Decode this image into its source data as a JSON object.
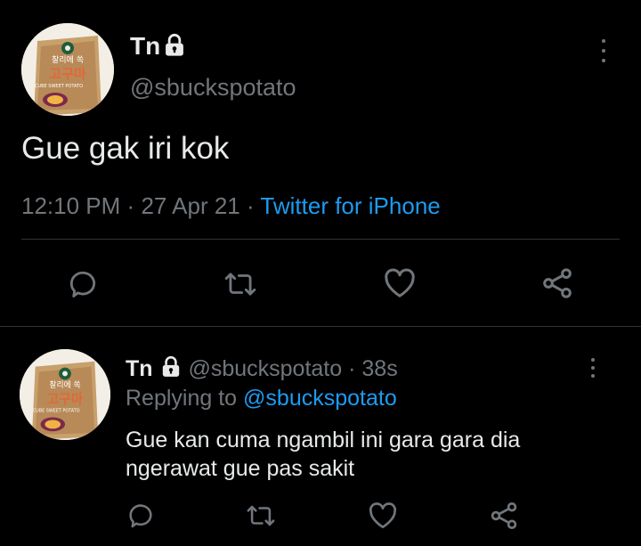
{
  "main_tweet": {
    "display_name": "Tn",
    "handle": "@sbuckspotato",
    "text": "Gue gak iri kok",
    "time": "12:10 PM",
    "sep1": "·",
    "date": "27 Apr 21",
    "sep2": "·",
    "source": "Twitter for iPhone",
    "avatar_text": {
      "brand": "찰리에 쏙",
      "korean": "고구마",
      "english": "CUBE SWEET POTATO"
    }
  },
  "reply_tweet": {
    "display_name": "Tn",
    "handle": "@sbuckspotato",
    "sep": "·",
    "age": "38s",
    "replying_prefix": "Replying to",
    "replying_to": "@sbuckspotato",
    "line1": "Gue kan cuma ngambil ini gara gara dia",
    "line2": "ngerawat gue pas sakit",
    "avatar_text": {
      "brand": "찰리에 쏙",
      "korean": "고구마",
      "english": "CUBE SWEET POTATO"
    }
  },
  "icons": {
    "reply": "reply-icon",
    "retweet": "retweet-icon",
    "like": "heart-icon",
    "share": "share-icon",
    "lock": "lock-icon",
    "more": "more-icon"
  },
  "colors": {
    "background": "#000000",
    "text": "#e7e9ea",
    "muted": "#71767b",
    "link": "#1d9bf0",
    "divider": "#2f3336"
  }
}
